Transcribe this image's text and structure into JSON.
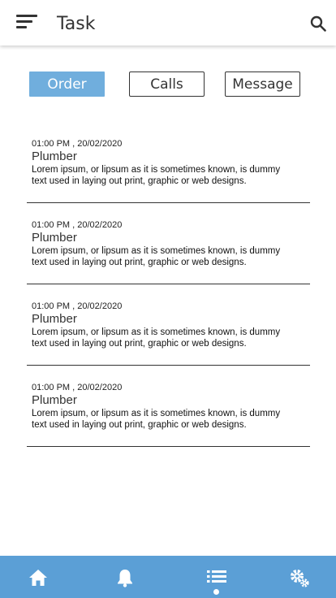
{
  "header": {
    "title": "Task",
    "menu_icon": "menu-icon",
    "search_icon": "search-icon"
  },
  "tabs": [
    {
      "label": "Order",
      "active": true
    },
    {
      "label": "Calls",
      "active": false
    },
    {
      "label": "Message",
      "active": false
    }
  ],
  "tasks": [
    {
      "time": "01:00 PM , 20/02/2020",
      "title": "Plumber",
      "description": "Lorem ipsum, or lipsum as it is sometimes known, is dummy text used in laying out print, graphic or web designs."
    },
    {
      "time": "01:00 PM , 20/02/2020",
      "title": "Plumber",
      "description": "Lorem ipsum, or lipsum as it is sometimes known, is dummy text used in laying out print, graphic or web designs."
    },
    {
      "time": "01:00 PM , 20/02/2020",
      "title": "Plumber",
      "description": "Lorem ipsum, or lipsum as it is sometimes known, is dummy text used in laying out print, graphic or web designs."
    },
    {
      "time": "01:00 PM , 20/02/2020",
      "title": "Plumber",
      "description": "Lorem ipsum, or lipsum as it is sometimes known, is dummy text used in laying out print, graphic or web designs."
    }
  ],
  "bottom_nav": {
    "items": [
      "home-icon",
      "bell-icon",
      "list-icon",
      "settings-icon"
    ],
    "active_index": 2
  },
  "colors": {
    "accent": "#70aedd",
    "nav_background": "#5b9fd6"
  }
}
